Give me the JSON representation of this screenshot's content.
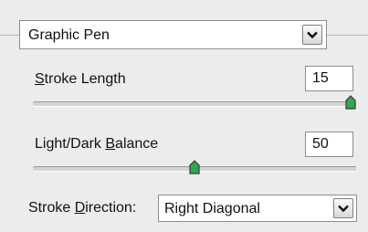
{
  "filter": {
    "selected": "Graphic Pen"
  },
  "stroke_length": {
    "label_pre": "",
    "label_key": "S",
    "label_post": "troke Length",
    "value": "15",
    "level": 1.0
  },
  "light_dark_balance": {
    "label_pre": "Light/Dark ",
    "label_key": "B",
    "label_post": "alance",
    "value": "50",
    "level": 0.5
  },
  "stroke_direction": {
    "label_pre": "Stroke ",
    "label_key": "D",
    "label_post": "irection:",
    "selected": "Right Diagonal"
  },
  "icons": {
    "dropdown": "chevron-down-icon",
    "slider_thumb": "slider-thumb-icon"
  },
  "colors": {
    "thumb_fill": "#2fa84f",
    "thumb_stroke": "#3a3a3a"
  }
}
